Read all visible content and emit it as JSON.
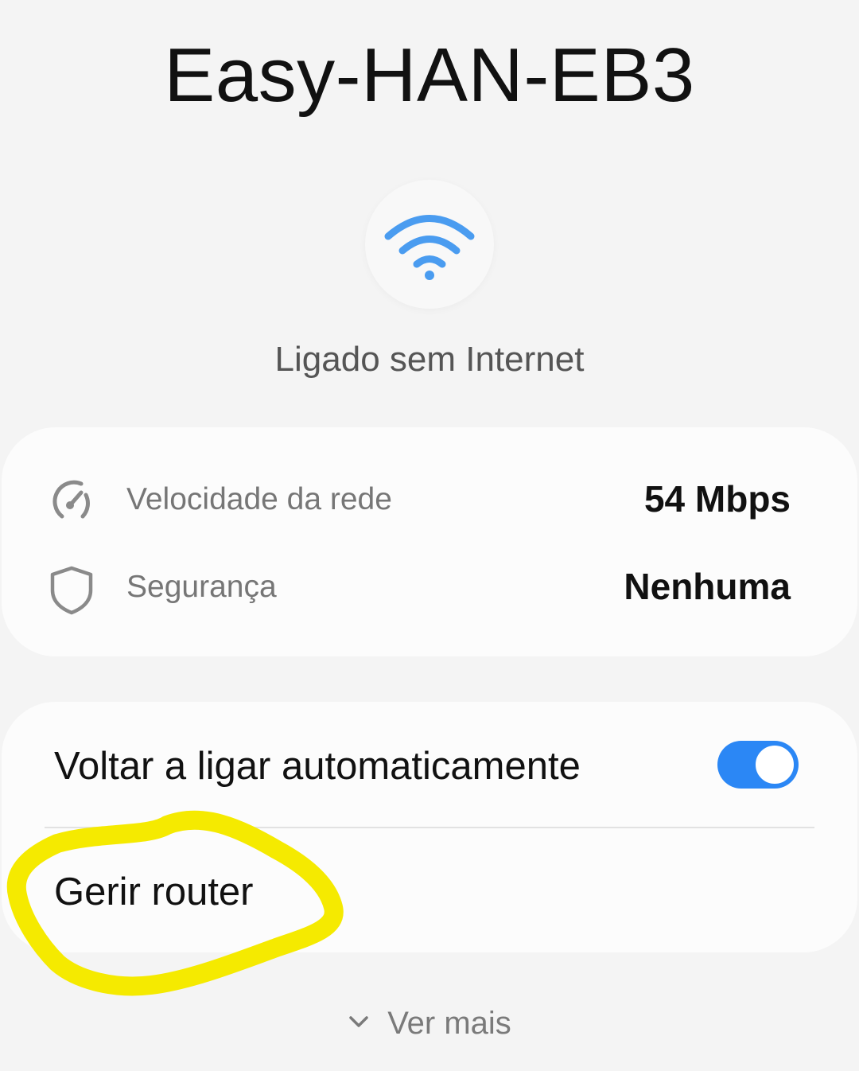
{
  "network": {
    "ssid": "Easy-HAN-EB3",
    "status": "Ligado sem Internet",
    "icon": "wifi-icon"
  },
  "info": {
    "speed": {
      "icon": "speedometer-icon",
      "label": "Velocidade da rede",
      "value": "54 Mbps"
    },
    "security": {
      "icon": "shield-icon",
      "label": "Segurança",
      "value": "Nenhuma"
    }
  },
  "actions": {
    "auto_reconnect": {
      "label": "Voltar a ligar automaticamente",
      "enabled": true
    },
    "manage_router": {
      "label": "Gerir router"
    }
  },
  "see_more": {
    "icon": "chevron-down-icon",
    "label": "Ver mais"
  },
  "colors": {
    "background": "#f4f4f4",
    "card": "#fcfcfc",
    "accent": "#2b87f5",
    "wifi_icon": "#4a9cf0",
    "highlight": "#f5ea00"
  }
}
